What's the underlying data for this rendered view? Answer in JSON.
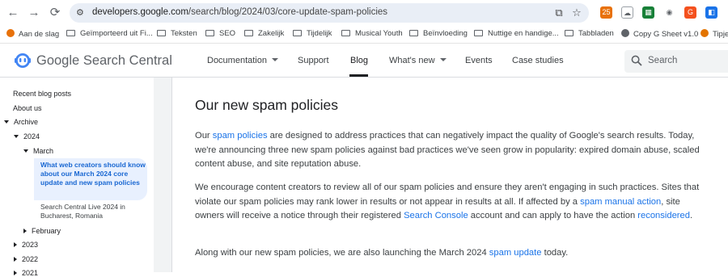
{
  "browser": {
    "url_host": "developers.google.com",
    "url_path": "/search/blog/2024/03/core-update-spam-policies",
    "bookmarks": [
      "Aan de slag",
      "Geïmporteerd uit Fi...",
      "Teksten",
      "SEO",
      "Zakelijk",
      "Tijdelijk",
      "Musical Youth",
      "Beïnvloeding",
      "Nuttige en handige...",
      "Tabbladen",
      "Copy G Sheet v1.0",
      "Tipje"
    ],
    "extension_badge": "25"
  },
  "header": {
    "brand_google": "Google",
    "brand_product": "Search Central",
    "nav": [
      {
        "label": "Documentation",
        "has_menu": true
      },
      {
        "label": "Support",
        "has_menu": false
      },
      {
        "label": "Blog",
        "has_menu": false,
        "active": true
      },
      {
        "label": "What's new",
        "has_menu": true
      },
      {
        "label": "Events",
        "has_menu": false
      },
      {
        "label": "Case studies",
        "has_menu": false
      }
    ],
    "search_placeholder": "Search"
  },
  "sidebar": {
    "recent": "Recent blog posts",
    "about": "About us",
    "archive": "Archive",
    "year_2024": "2024",
    "march": "March",
    "selected_post": "What web creators should know about our March 2024 core update and new spam policies",
    "other_post": "Search Central Live 2024 in Bucharest, Romania",
    "february": "February",
    "year_2023": "2023",
    "year_2022": "2022",
    "year_2021": "2021"
  },
  "article": {
    "title": "Our new spam policies",
    "p1_pre": "Our ",
    "p1_link": "spam policies",
    "p1_post": " are designed to address practices that can negatively impact the quality of Google's search results. Today, we're announcing three new spam policies against bad practices we've seen grow in popularity: expired domain abuse, scaled content abuse, and site reputation abuse.",
    "p2_pre": "We encourage content creators to review all of our spam policies and ensure they aren't engaging in such practices. Sites that violate our spam policies may rank lower in results or not appear in results at all. If affected by a ",
    "p2_link1": "spam manual action",
    "p2_mid": ", site owners will receive a notice through their registered ",
    "p2_link2": "Search Console",
    "p2_mid2": " account and can apply to have the action ",
    "p2_link3": "reconsidered",
    "p2_post": ".",
    "p3_pre": "Along with our new spam policies, we are also launching the March 2024 ",
    "p3_link": "spam update",
    "p3_post": " today."
  },
  "colors": {
    "link": "#1a73e8",
    "selected_bg": "#e8f0fe",
    "selected_text": "#1967d2"
  }
}
